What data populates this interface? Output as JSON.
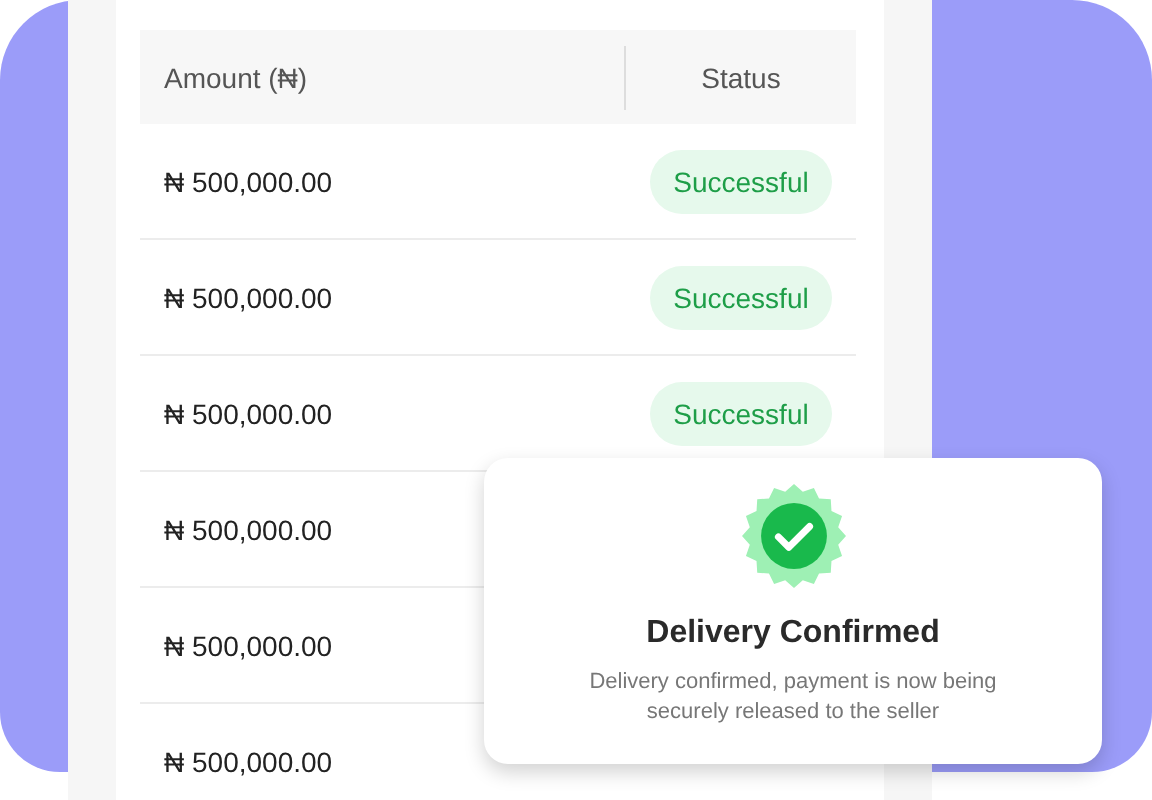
{
  "table": {
    "columns": [
      "Amount (₦)",
      "Status"
    ],
    "rows": [
      {
        "amount": "₦ 500,000.00",
        "status": "Successful"
      },
      {
        "amount": "₦ 500,000.00",
        "status": "Successful"
      },
      {
        "amount": "₦ 500,000.00",
        "status": "Successful"
      },
      {
        "amount": "₦ 500,000.00"
      },
      {
        "amount": "₦ 500,000.00"
      },
      {
        "amount": "₦ 500,000.00"
      }
    ]
  },
  "toast": {
    "title": "Delivery Confirmed",
    "message": "Delivery confirmed, payment is now being securely released to the seller"
  }
}
